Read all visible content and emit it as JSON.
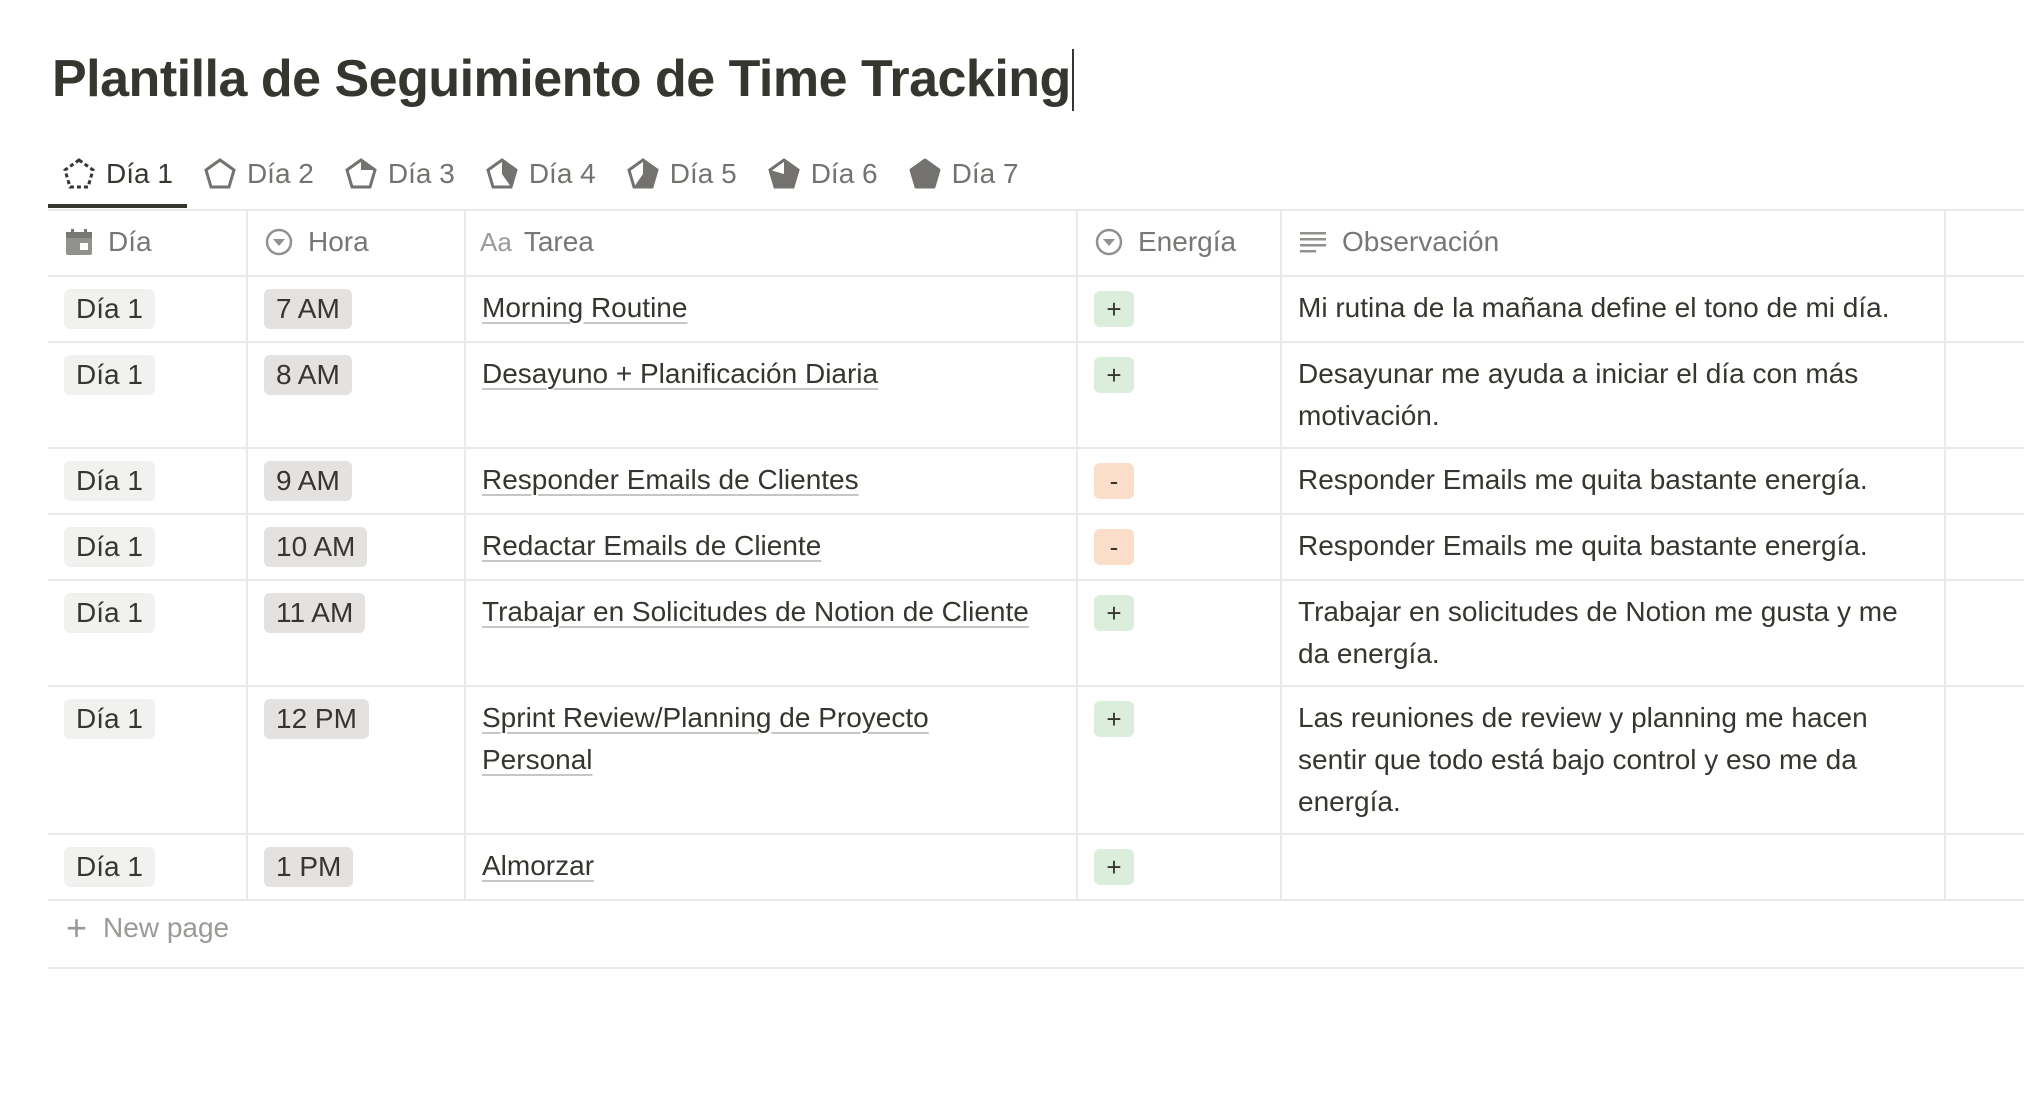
{
  "page": {
    "title": "Plantilla de Seguimiento de Time Tracking"
  },
  "tabs": [
    {
      "label": "Día 1",
      "active": true
    },
    {
      "label": "Día 2"
    },
    {
      "label": "Día 3"
    },
    {
      "label": "Día 4"
    },
    {
      "label": "Día 5"
    },
    {
      "label": "Día 6"
    },
    {
      "label": "Día 7"
    }
  ],
  "table": {
    "headers": {
      "dia": "Día",
      "hora": "Hora",
      "tarea_prefix": "Aa",
      "tarea": "Tarea",
      "energia": "Energía",
      "observacion": "Observación"
    },
    "rows": [
      {
        "dia": "Día 1",
        "hora": "7 AM",
        "tarea": "Morning Routine",
        "energia": "+",
        "observacion": "Mi rutina de la mañana define el tono de mi día."
      },
      {
        "dia": "Día 1",
        "hora": "8 AM",
        "tarea": "Desayuno + Planificación Diaria",
        "energia": "+",
        "observacion": "Desayunar me ayuda a iniciar el día con más motivación."
      },
      {
        "dia": "Día 1",
        "hora": "9 AM",
        "tarea": "Responder Emails de Clientes",
        "energia": "-",
        "observacion": "Responder Emails me quita bastante energía."
      },
      {
        "dia": "Día 1",
        "hora": "10 AM",
        "tarea": "Redactar Emails de Cliente",
        "energia": "-",
        "observacion": "Responder Emails me quita bastante energía."
      },
      {
        "dia": "Día 1",
        "hora": "11 AM",
        "tarea": "Trabajar en Solicitudes de Notion de Cliente",
        "energia": "+",
        "observacion": "Trabajar en solicitudes de Notion me gusta y me da energía."
      },
      {
        "dia": "Día 1",
        "hora": "12 PM",
        "tarea": "Sprint Review/Planning de Proyecto Personal",
        "energia": "+",
        "observacion": "Las reuniones de review y planning me hacen sentir que todo está bajo control y eso me da energía."
      },
      {
        "dia": "Día 1",
        "hora": "1 PM",
        "tarea": "Almorzar",
        "energia": "+",
        "observacion": ""
      }
    ],
    "new_page": "New page"
  },
  "colors": {
    "energy_positive": "#dbeddb",
    "energy_negative": "#fadec9",
    "tag_bg": "#f1f1ef",
    "text": "#37352f"
  }
}
